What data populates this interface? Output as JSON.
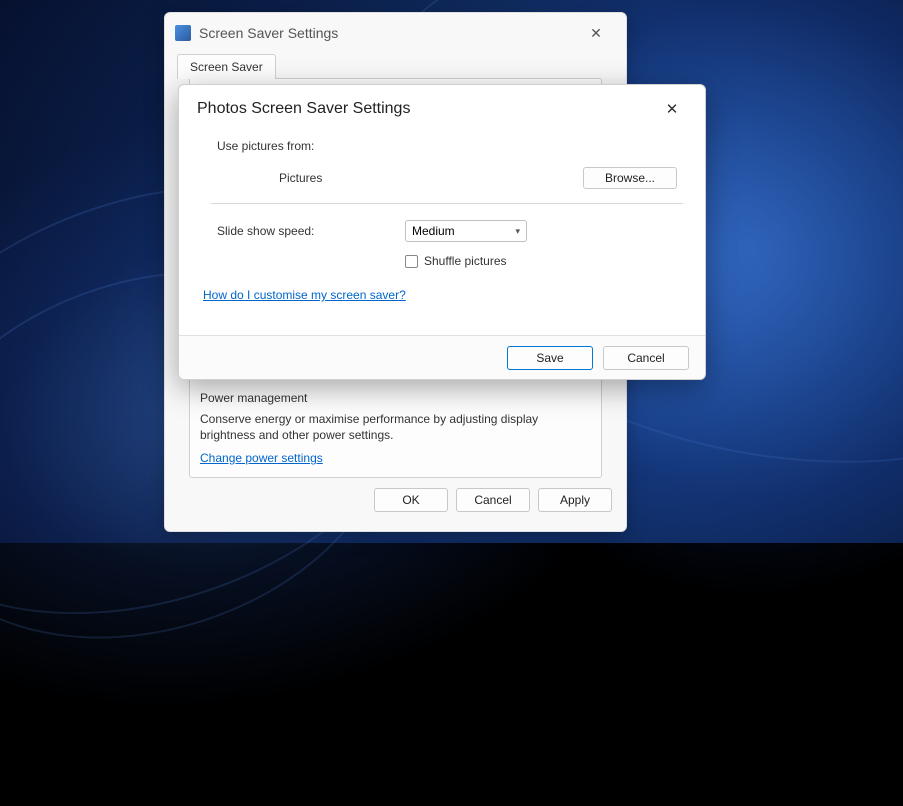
{
  "parent": {
    "title": "Screen Saver Settings",
    "tab_label": "Screen Saver",
    "power_mgmt": {
      "heading": "Power management",
      "description": "Conserve energy or maximise performance by adjusting display brightness and other power settings.",
      "link": "Change power settings"
    },
    "buttons": {
      "ok": "OK",
      "cancel": "Cancel",
      "apply": "Apply"
    }
  },
  "child": {
    "title": "Photos Screen Saver Settings",
    "use_pictures_label": "Use pictures from:",
    "pictures_folder": "Pictures",
    "browse_label": "Browse...",
    "speed_label": "Slide show speed:",
    "speed_value": "Medium",
    "shuffle_label": "Shuffle pictures",
    "help_link": "How do I customise my screen saver?",
    "buttons": {
      "save": "Save",
      "cancel": "Cancel"
    }
  }
}
